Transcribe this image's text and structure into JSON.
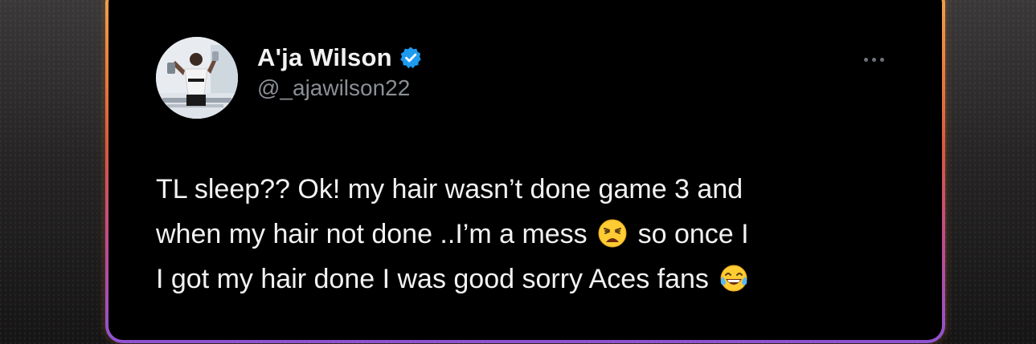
{
  "tweet": {
    "display_name": "A'ja Wilson",
    "handle": "@_ajawilson22",
    "verified_icon": "verified-badge-icon",
    "more_icon": "more-options-icon",
    "text_lines": [
      {
        "before": "TL sleep?? Ok!  my hair wasn’t done game 3 and",
        "emoji": "",
        "after": ""
      },
      {
        "before": "when my hair not done ..I’m a mess",
        "emoji": "weary-face-emoji",
        "after": "so once I"
      },
      {
        "before": "I got my hair done I was good sorry Aces fans",
        "emoji": "tears-of-joy-emoji",
        "after": ""
      }
    ]
  },
  "colors": {
    "verified_blue": "#1d9bf0",
    "card_background": "#000000",
    "handle_gray": "#8a8f95"
  }
}
